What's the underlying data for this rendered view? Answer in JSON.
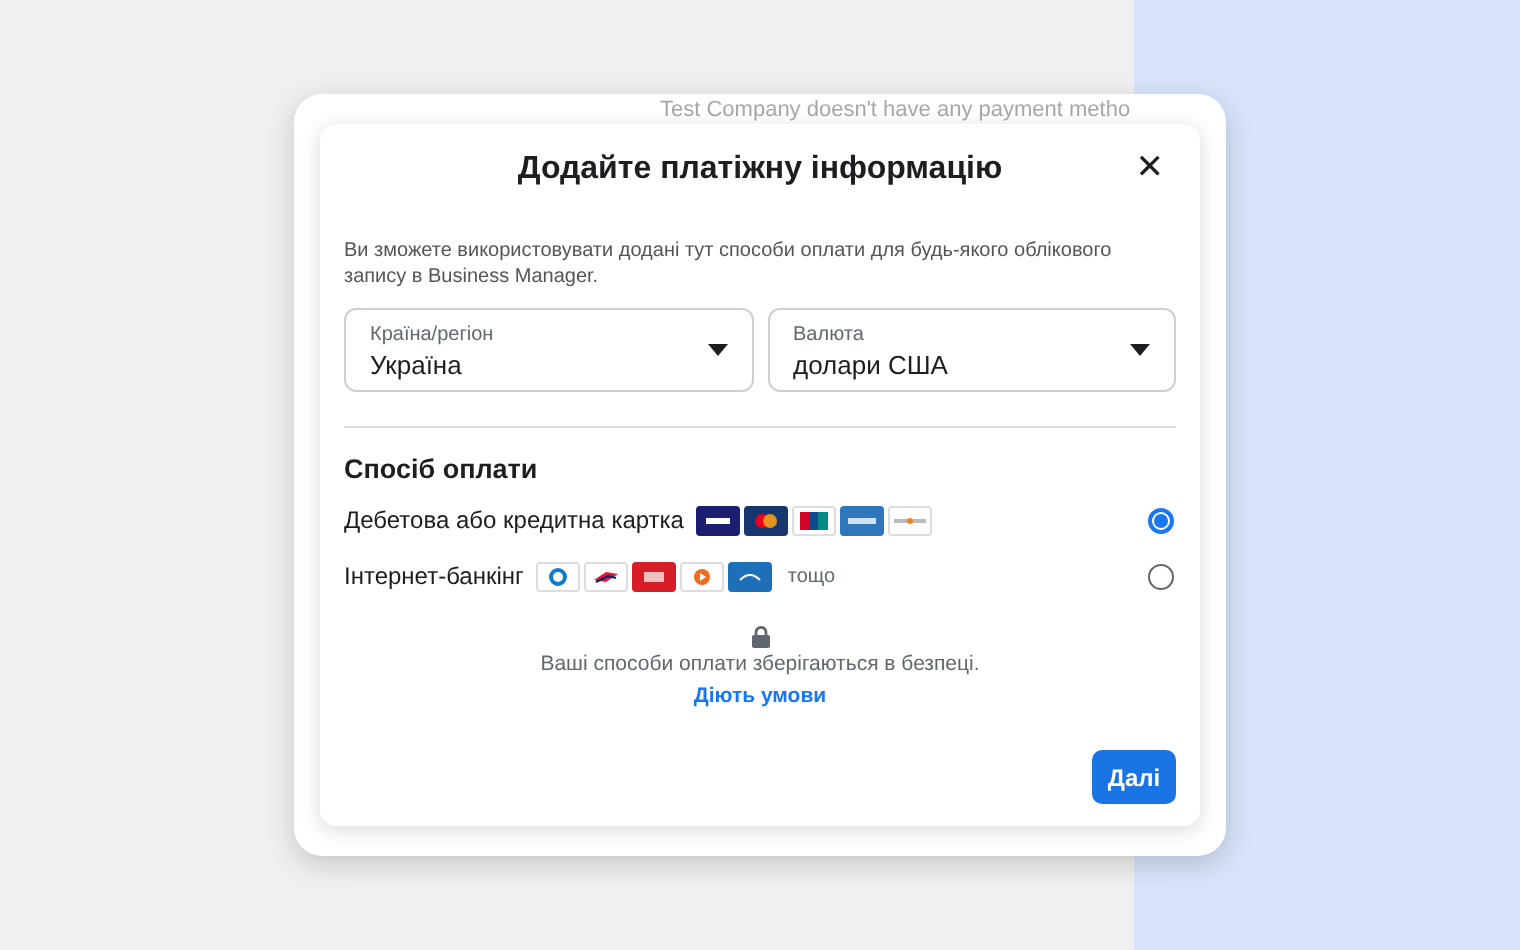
{
  "background_card": {
    "text": "Test Company doesn't have any payment metho"
  },
  "dialog": {
    "title": "Додайте платіжну інформацію",
    "close": "✕",
    "intro": "Ви зможете використовувати додані тут способи оплати для будь-якого облікового запису в Business Manager.",
    "selects": [
      {
        "label": "Країна/регіон",
        "value": "Україна"
      },
      {
        "label": "Валюта",
        "value": "долари США"
      }
    ],
    "section_title": "Спосіб оплати",
    "methods": [
      {
        "label": "Дебетова або кредитна картка",
        "kind": "cards",
        "selected": true
      },
      {
        "label": "Інтернет-банкінг",
        "kind": "banks",
        "suffix": "тощо",
        "selected": false
      }
    ],
    "security_note": "Ваші способи оплати зберігаються в безпеці.",
    "terms_link": "Діють умови",
    "next_button": "Далі"
  }
}
